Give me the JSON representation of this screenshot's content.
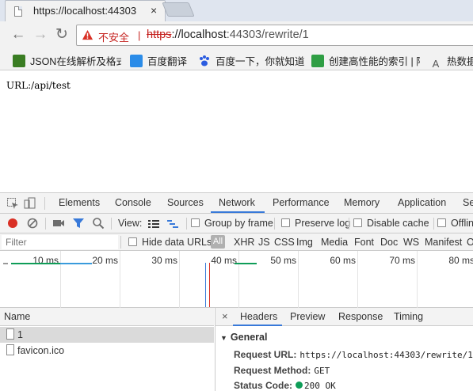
{
  "browser": {
    "tab": {
      "title": "https://localhost:44303",
      "close_glyph": "×"
    },
    "omnibox": {
      "security_label": "不安全",
      "separator": "|",
      "url_scheme": "https",
      "url_host": "://localhost",
      "url_port_path": ":44303/rewrite/1"
    },
    "bookmarks": [
      {
        "label": "JSON在线解析及格式",
        "icon": "json-icon",
        "color": "#3a7d23"
      },
      {
        "label": "百度翻译",
        "icon": "translate-icon",
        "color": "#2b8ce8"
      },
      {
        "label": "百度一下，你就知道",
        "icon": "baidu-paw-icon",
        "color": "#2b5ce0"
      },
      {
        "label": "创建高性能的索引 | 阿",
        "icon": "evernote-icon",
        "color": "#2f9e44"
      },
      {
        "label": "热数据",
        "icon": "font-icon",
        "color": "#555555"
      }
    ]
  },
  "page": {
    "content": "URL:/api/test"
  },
  "devtools": {
    "tabs": [
      "Elements",
      "Console",
      "Sources",
      "Network",
      "Performance",
      "Memory",
      "Application",
      "Se"
    ],
    "active_tab": "Network",
    "toolbar": {
      "view_label": "View:",
      "group_by_frame": "Group by frame",
      "preserve_log": "Preserve log",
      "disable_cache": "Disable cache",
      "offline": "Offlin"
    },
    "filter": {
      "placeholder": "Filter",
      "hide_data_urls": "Hide data URLs",
      "all": "All",
      "types": [
        "XHR",
        "JS",
        "CSS",
        "Img",
        "Media",
        "Font",
        "Doc",
        "WS",
        "Manifest",
        "O"
      ]
    },
    "timeline_ticks": [
      "10 ms",
      "20 ms",
      "30 ms",
      "40 ms",
      "50 ms",
      "60 ms",
      "70 ms",
      "80 ms"
    ],
    "requests": {
      "header": "Name",
      "rows": [
        {
          "name": "1",
          "selected": true
        },
        {
          "name": "favicon.ico",
          "selected": false
        }
      ]
    },
    "details": {
      "close_glyph": "×",
      "tabs": [
        "Headers",
        "Preview",
        "Response",
        "Timing"
      ],
      "active_tab": "Headers",
      "section": "General",
      "fields": [
        {
          "key": "Request URL:",
          "value": "https://localhost:44303/rewrite/1"
        },
        {
          "key": "Request Method:",
          "value": "GET"
        },
        {
          "key": "Status Code:",
          "value": "200 OK"
        }
      ],
      "status_color": "#0f9d58"
    }
  },
  "colors": {
    "accent_blue": "#3879d9",
    "record_red": "#d93025",
    "insecure_red": "#c5221f"
  }
}
